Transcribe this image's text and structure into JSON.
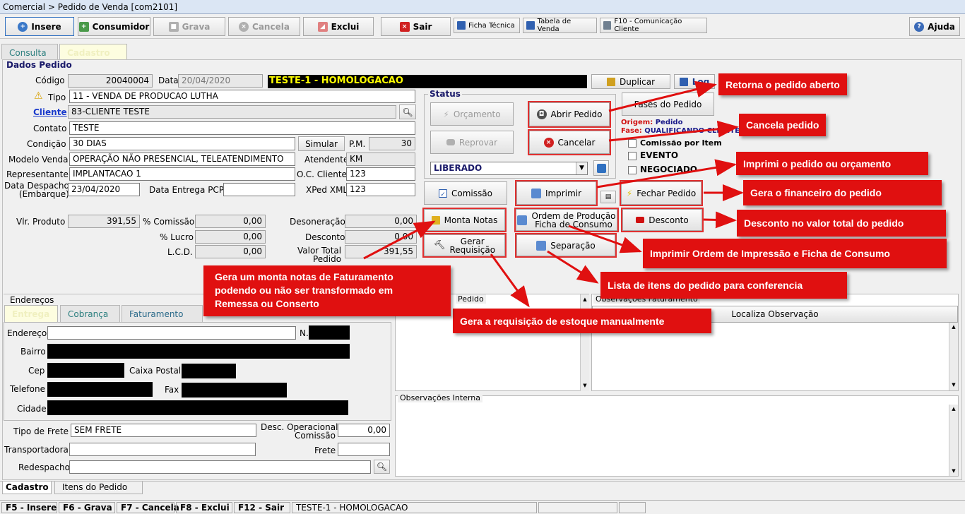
{
  "window": {
    "title": "Comercial > Pedido de Venda [com2101]"
  },
  "toolbar": {
    "insere": "Insere",
    "consumidor": "Consumidor",
    "grava": "Grava",
    "cancela": "Cancela",
    "exclui": "Exclui",
    "sair": "Sair",
    "ficha_tecnica": "Ficha Técnica",
    "tabela_venda": "Tabela de Venda",
    "f10": "F10 - Comunicação Cliente",
    "ajuda": "Ajuda"
  },
  "tabs": {
    "consulta": "Consulta",
    "cadastro": "Cadastro"
  },
  "dados": {
    "section": "Dados Pedido",
    "codigo_label": "Código",
    "codigo": "20040004",
    "data_label": "Data",
    "data": "20/04/2020",
    "banner": "TESTE-1 - HOMOLOGACAO",
    "tipo_label": "Tipo",
    "tipo": "11 - VENDA DE PRODUCAO LUTHA",
    "cliente_label": "Cliente",
    "cliente": "83-CLIENTE TESTE",
    "contato_label": "Contato",
    "contato": "TESTE",
    "condicao_label": "Condição",
    "condicao": "30 DIAS",
    "simular": "Simular",
    "pm_label": "P.M.",
    "pm": "30",
    "modelo_label": "Modelo Venda",
    "modelo": "OPERAÇÃO NÃO PRESENCIAL, TELEATENDIMENTO",
    "atendente_label": "Atendente",
    "atendente": "KM",
    "representante_label": "Representante",
    "representante": "IMPLANTACAO 1",
    "oc_label": "O.C. Cliente",
    "oc": "123",
    "despacho_label1": "Data Despacho",
    "despacho_label2": "(Embarque)",
    "despacho": "23/04/2020",
    "entrega_label": "Data Entrega PCP",
    "entrega": "",
    "xped_label": "XPed XML",
    "xped": "123",
    "vlr_label": "Vlr. Produto",
    "vlr": "391,55",
    "comissao_label": "% Comissão",
    "comissao": "0,00",
    "desoneracao_label": "Desoneração",
    "desoneracao": "0,00",
    "lucro_label": "% Lucro",
    "lucro": "0,00",
    "desconto_label": "Desconto",
    "desconto": "0,00",
    "lcd_label": "L.C.D.",
    "lcd": "0,00",
    "total_label1": "Valor Total",
    "total_label2": "Pedido",
    "total": "391,55"
  },
  "actions": {
    "duplicar": "Duplicar",
    "log": "Log",
    "fases": "Fases do Pedido",
    "status_title": "Status",
    "orcamento": "Orçamento",
    "abrir": "Abrir Pedido",
    "reprovar": "Reprovar",
    "cancelar": "Cancelar",
    "status_value": "LIBERADO",
    "origem_label": "Origem:",
    "origem": "Pedido",
    "fase_label": "Fase:",
    "fase": "QUALIFICANDO CLIENTE",
    "comissao_item": "Comissão por Item",
    "evento": "EVENTO",
    "negociado": "NEGOCIADO",
    "comissao": "Comissão",
    "imprimir": "Imprimir",
    "fechar": "Fechar Pedido",
    "monta": "Monta Notas",
    "ordem1": "Ordem de Produção",
    "ordem2": "Ficha de Consumo",
    "desconto": "Desconto",
    "gerar1": "Gerar",
    "gerar2": "Requisição",
    "separacao": "Separação"
  },
  "callouts": {
    "c1": "Retorna o pedido aberto",
    "c2": "Cancela pedido",
    "c3": "Imprimi o pedido ou orçamento",
    "c4": "Gera o financeiro do pedido",
    "c5": "Desconto no valor total do pedido",
    "c6": "Imprimir Ordem de Impressão e Ficha de Consumo",
    "c7": "Lista de itens do pedido para conferencia",
    "c8": "Gera a requisição de estoque manualmente",
    "c9a": "Gera um monta notas de Faturamento",
    "c9b": "podendo ou não ser transformado em",
    "c9c": "Remessa ou Conserto"
  },
  "enderecos": {
    "section": "Endereços",
    "tab_entrega": "Entrega",
    "tab_cobranca": "Cobrança",
    "tab_faturamento": "Faturamento",
    "endereco": "Endereço",
    "n": "N.",
    "bairro": "Bairro",
    "cep": "Cep",
    "caixa": "Caixa Postal",
    "telefone": "Telefone",
    "fax": "Fax",
    "cidade": "Cidade"
  },
  "frete": {
    "tipo_label": "Tipo de Frete",
    "tipo": "SEM FRETE",
    "desc_label1": "Desc. Operacional",
    "desc_label2": "Comissão",
    "desc": "0,00",
    "transp_label": "Transportadora",
    "frete_label": "Frete",
    "redespacho_label": "Redespacho"
  },
  "obs": {
    "pedido": "Pedido",
    "faturamento": "Observações Faturamento",
    "localiza": "Localiza Observação",
    "interna": "Observações Interna"
  },
  "bottom_tabs": {
    "cadastro": "Cadastro",
    "itens": "Itens do Pedido"
  },
  "statusbar": {
    "f5": "F5 - Insere",
    "f6": "F6 - Grava",
    "f7": "F7 - Cancela",
    "f8": "F8 - Exclui",
    "f12": "F12 - Sair",
    "env": "TESTE-1 - HOMOLOGACAO"
  },
  "colors": {
    "callout": "#e01010",
    "banner": "#000000",
    "banner_text": "#ffff00"
  }
}
